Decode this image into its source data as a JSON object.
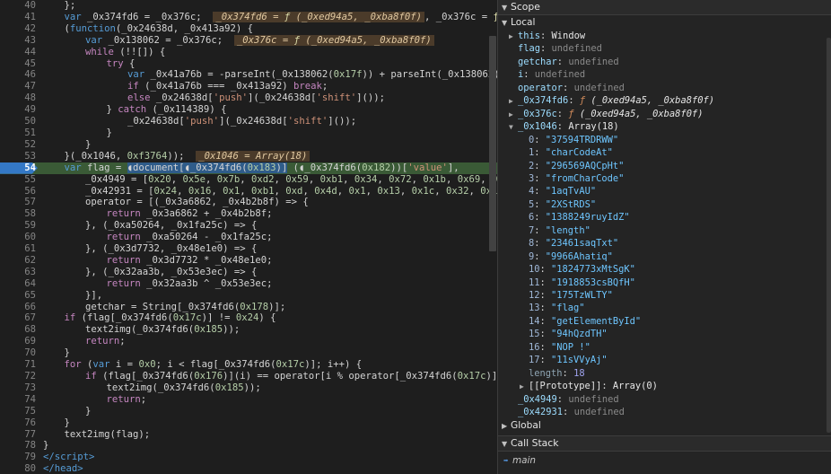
{
  "editor": {
    "lines": [
      {
        "n": "40",
        "indent": 1,
        "html": "};"
      },
      {
        "n": "41",
        "indent": 1,
        "html": "<span class=\"kw\">var</span> _0x374fd6 = _0x376c;  <span class=\"inline-val\">_0x374fd6 = <span class=\"fn\">ƒ</span> (_0xed94a5, _0xba8f0f)</span>, _0x376c = <span class=\"fn\">ƒ</span> (_"
      },
      {
        "n": "42",
        "indent": 1,
        "html": "(<span class=\"kw\">function</span>(_0x24638d, _0x413a92) {"
      },
      {
        "n": "43",
        "indent": 2,
        "html": "<span class=\"kw\">var</span> _0x138062 = _0x376c;  <span class=\"inline-val\">_0x376c = <span class=\"fn\">ƒ</span> (_0xed94a5, _0xba8f0f)</span>"
      },
      {
        "n": "44",
        "indent": 2,
        "html": "<span class=\"ctl\">while</span> (!![]) {"
      },
      {
        "n": "45",
        "indent": 3,
        "html": "<span class=\"ctl\">try</span> {"
      },
      {
        "n": "46",
        "indent": 4,
        "html": "<span class=\"kw\">var</span> _0x41a76b = -parseInt(_0x138062(<span class=\"num\">0x17f</span>)) + parseInt(_0x138062(<span class=\"num\">0</span>"
      },
      {
        "n": "47",
        "indent": 4,
        "html": "<span class=\"ctl\">if</span> (_0x41a76b === _0x413a92) <span class=\"ctl\">break</span>;"
      },
      {
        "n": "48",
        "indent": 4,
        "html": "<span class=\"ctl\">else</span> _0x24638d[<span class=\"str\">'push'</span>](_0x24638d[<span class=\"str\">'shift'</span>]());"
      },
      {
        "n": "49",
        "indent": 3,
        "html": "} <span class=\"ctl\">catch</span> (_0x114389) {"
      },
      {
        "n": "50",
        "indent": 4,
        "html": "_0x24638d[<span class=\"str\">'push'</span>](_0x24638d[<span class=\"str\">'shift'</span>]());"
      },
      {
        "n": "51",
        "indent": 3,
        "html": "}"
      },
      {
        "n": "52",
        "indent": 2,
        "html": "}"
      },
      {
        "n": "53",
        "indent": 1,
        "html": "}(_0x1046, <span class=\"num\">0xf3764</span>));  <span class=\"inline-val\">_0x1046 = Array(18)</span>"
      },
      {
        "n": "54",
        "indent": 1,
        "exec": true,
        "html": "<span class=\"kw\">var</span> flag = <span class=\"hl-pause\">◖document[◖_0x374fd6(<span class=\"num\">0x183</span>)]</span> (◖_0x374fd6(<span class=\"num\">0x182</span>))[<span class=\"str\">'value'</span>],"
      },
      {
        "n": "55",
        "indent": 2,
        "html": "_0x4949 = [<span class=\"num\">0x20</span>, <span class=\"num\">0x5e</span>, <span class=\"num\">0x7b</span>, <span class=\"num\">0xd2</span>, <span class=\"num\">0x59</span>, <span class=\"num\">0xb1</span>, <span class=\"num\">0x34</span>, <span class=\"num\">0x72</span>, <span class=\"num\">0x1b</span>, <span class=\"num\">0x69</span>, <span class=\"num\">0x6</span>"
      },
      {
        "n": "56",
        "indent": 2,
        "html": "_0x42931 = [<span class=\"num\">0x24</span>, <span class=\"num\">0x16</span>, <span class=\"num\">0x1</span>, <span class=\"num\">0xb1</span>, <span class=\"num\">0xd</span>, <span class=\"num\">0x4d</span>, <span class=\"num\">0x1</span>, <span class=\"num\">0x13</span>, <span class=\"num\">0x1c</span>, <span class=\"num\">0x32</span>, <span class=\"num\">0x1</span>,"
      },
      {
        "n": "57",
        "indent": 2,
        "html": "operator = [(_0x3a6862, _0x4b2b8f) => {"
      },
      {
        "n": "58",
        "indent": 3,
        "html": "<span class=\"ctl\">return</span> _0x3a6862 + _0x4b2b8f;"
      },
      {
        "n": "59",
        "indent": 2,
        "html": "}, (_0xa50264, _0x1fa25c) => {"
      },
      {
        "n": "60",
        "indent": 3,
        "html": "<span class=\"ctl\">return</span> _0xa50264 - _0x1fa25c;"
      },
      {
        "n": "61",
        "indent": 2,
        "html": "}, (_0x3d7732, _0x48e1e0) => {"
      },
      {
        "n": "62",
        "indent": 3,
        "html": "<span class=\"ctl\">return</span> _0x3d7732 * _0x48e1e0;"
      },
      {
        "n": "63",
        "indent": 2,
        "html": "}, (_0x32aa3b, _0x53e3ec) => {"
      },
      {
        "n": "64",
        "indent": 3,
        "html": "<span class=\"ctl\">return</span> _0x32aa3b ^ _0x53e3ec;"
      },
      {
        "n": "65",
        "indent": 2,
        "html": "}],"
      },
      {
        "n": "66",
        "indent": 2,
        "html": "getchar = String[_0x374fd6(<span class=\"num\">0x178</span>)];"
      },
      {
        "n": "67",
        "indent": 1,
        "html": "<span class=\"ctl\">if</span> (flag[_0x374fd6(<span class=\"num\">0x17c</span>)] != <span class=\"num\">0x24</span>) {"
      },
      {
        "n": "68",
        "indent": 2,
        "html": "text2img(_0x374fd6(<span class=\"num\">0x185</span>));"
      },
      {
        "n": "69",
        "indent": 2,
        "html": "<span class=\"ctl\">return</span>;"
      },
      {
        "n": "70",
        "indent": 1,
        "html": "}"
      },
      {
        "n": "71",
        "indent": 1,
        "html": "<span class=\"ctl\">for</span> (<span class=\"kw\">var</span> i = <span class=\"num\">0x0</span>; i < flag[_0x374fd6(<span class=\"num\">0x17c</span>)]; i++) {"
      },
      {
        "n": "72",
        "indent": 2,
        "html": "<span class=\"ctl\">if</span> (flag[_0x374fd6(<span class=\"num\">0x176</span>)](i) == operator[i % operator[_0x374fd6(<span class=\"num\">0x17c</span>)]]("
      },
      {
        "n": "73",
        "indent": 3,
        "html": "text2img(_0x374fd6(<span class=\"num\">0x185</span>));"
      },
      {
        "n": "74",
        "indent": 3,
        "html": "<span class=\"ctl\">return</span>;"
      },
      {
        "n": "75",
        "indent": 2,
        "html": "}"
      },
      {
        "n": "76",
        "indent": 1,
        "html": "}"
      },
      {
        "n": "77",
        "indent": 1,
        "html": "text2img(flag);"
      },
      {
        "n": "78",
        "indent": 0,
        "html": "}"
      },
      {
        "n": "79",
        "indent": 0,
        "html": "<span class=\"tag\">&lt;/script&gt;</span>"
      },
      {
        "n": "80",
        "indent": 0,
        "html": "<span class=\"tag\">&lt;/head&gt;</span>"
      }
    ]
  },
  "panel": {
    "scope_title": "Scope",
    "local_title": "Local",
    "global_title": "Global",
    "callstack_title": "Call Stack",
    "callstack_frame": "main",
    "local_rows": [
      {
        "tw": "▶",
        "k": "this",
        "kc": "k",
        "v": "Window",
        "vc": "obj",
        "lvl": 1
      },
      {
        "tw": "",
        "k": "flag",
        "kc": "k",
        "v": "undefined",
        "vc": "undef",
        "lvl": 1
      },
      {
        "tw": "",
        "k": "getchar",
        "kc": "k",
        "v": "undefined",
        "vc": "undef",
        "lvl": 1
      },
      {
        "tw": "",
        "k": "i",
        "kc": "k",
        "v": "undefined",
        "vc": "undef",
        "lvl": 1
      },
      {
        "tw": "",
        "k": "operator",
        "kc": "k",
        "v": "undefined",
        "vc": "undef",
        "lvl": 1
      },
      {
        "tw": "▶",
        "k": "_0x374fd6",
        "kc": "k",
        "v": "ƒ (_0xed94a5, _0xba8f0f)",
        "vc": "fsig",
        "lvl": 1
      },
      {
        "tw": "▶",
        "k": "_0x376c",
        "kc": "k",
        "v": "ƒ (_0xed94a5, _0xba8f0f)",
        "vc": "fsig",
        "lvl": 1
      },
      {
        "tw": "▼",
        "k": "_0x1046",
        "kc": "k",
        "v": "Array(18)",
        "vc": "obj",
        "lvl": 1
      },
      {
        "tw": "",
        "k": "0",
        "kc": "idx",
        "v": "\"37594TRDRWW\"",
        "vc": "sv",
        "lvl": 2
      },
      {
        "tw": "",
        "k": "1",
        "kc": "idx",
        "v": "\"charCodeAt\"",
        "vc": "sv",
        "lvl": 2
      },
      {
        "tw": "",
        "k": "2",
        "kc": "idx",
        "v": "\"296569AQCpHt\"",
        "vc": "sv",
        "lvl": 2
      },
      {
        "tw": "",
        "k": "3",
        "kc": "idx",
        "v": "\"fromCharCode\"",
        "vc": "sv",
        "lvl": 2
      },
      {
        "tw": "",
        "k": "4",
        "kc": "idx",
        "v": "\"1aqTvAU\"",
        "vc": "sv",
        "lvl": 2
      },
      {
        "tw": "",
        "k": "5",
        "kc": "idx",
        "v": "\"2XStRDS\"",
        "vc": "sv",
        "lvl": 2
      },
      {
        "tw": "",
        "k": "6",
        "kc": "idx",
        "v": "\"1388249ruyIdZ\"",
        "vc": "sv",
        "lvl": 2
      },
      {
        "tw": "",
        "k": "7",
        "kc": "idx",
        "v": "\"length\"",
        "vc": "sv",
        "lvl": 2
      },
      {
        "tw": "",
        "k": "8",
        "kc": "idx",
        "v": "\"23461saqTxt\"",
        "vc": "sv",
        "lvl": 2
      },
      {
        "tw": "",
        "k": "9",
        "kc": "idx",
        "v": "\"9966Ahatiq\"",
        "vc": "sv",
        "lvl": 2
      },
      {
        "tw": "",
        "k": "10",
        "kc": "idx",
        "v": "\"1824773xMtSgK\"",
        "vc": "sv",
        "lvl": 2
      },
      {
        "tw": "",
        "k": "11",
        "kc": "idx",
        "v": "\"1918853csBQfH\"",
        "vc": "sv",
        "lvl": 2
      },
      {
        "tw": "",
        "k": "12",
        "kc": "idx",
        "v": "\"175TzWLTY\"",
        "vc": "sv",
        "lvl": 2
      },
      {
        "tw": "",
        "k": "13",
        "kc": "idx",
        "v": "\"flag\"",
        "vc": "sv",
        "lvl": 2
      },
      {
        "tw": "",
        "k": "14",
        "kc": "idx",
        "v": "\"getElementById\"",
        "vc": "sv",
        "lvl": 2
      },
      {
        "tw": "",
        "k": "15",
        "kc": "idx",
        "v": "\"94hQzdTH\"",
        "vc": "sv",
        "lvl": 2
      },
      {
        "tw": "",
        "k": "16",
        "kc": "idx",
        "v": "\"NOP !\"",
        "vc": "sv",
        "lvl": 2
      },
      {
        "tw": "",
        "k": "17",
        "kc": "idx",
        "v": "\"11sVVyAj\"",
        "vc": "sv",
        "lvl": 2
      },
      {
        "tw": "",
        "k": "length",
        "kc": "kdim",
        "v": "18",
        "vc": "nv",
        "lvl": 2
      },
      {
        "tw": "▶",
        "k": "[[Prototype]]",
        "kc": "obj",
        "v": "Array(0)",
        "vc": "obj",
        "lvl": 2
      },
      {
        "tw": "",
        "k": "_0x4949",
        "kc": "k",
        "v": "undefined",
        "vc": "undef",
        "lvl": 1
      },
      {
        "tw": "",
        "k": "_0x42931",
        "kc": "k",
        "v": "undefined",
        "vc": "undef",
        "lvl": 1
      }
    ]
  }
}
